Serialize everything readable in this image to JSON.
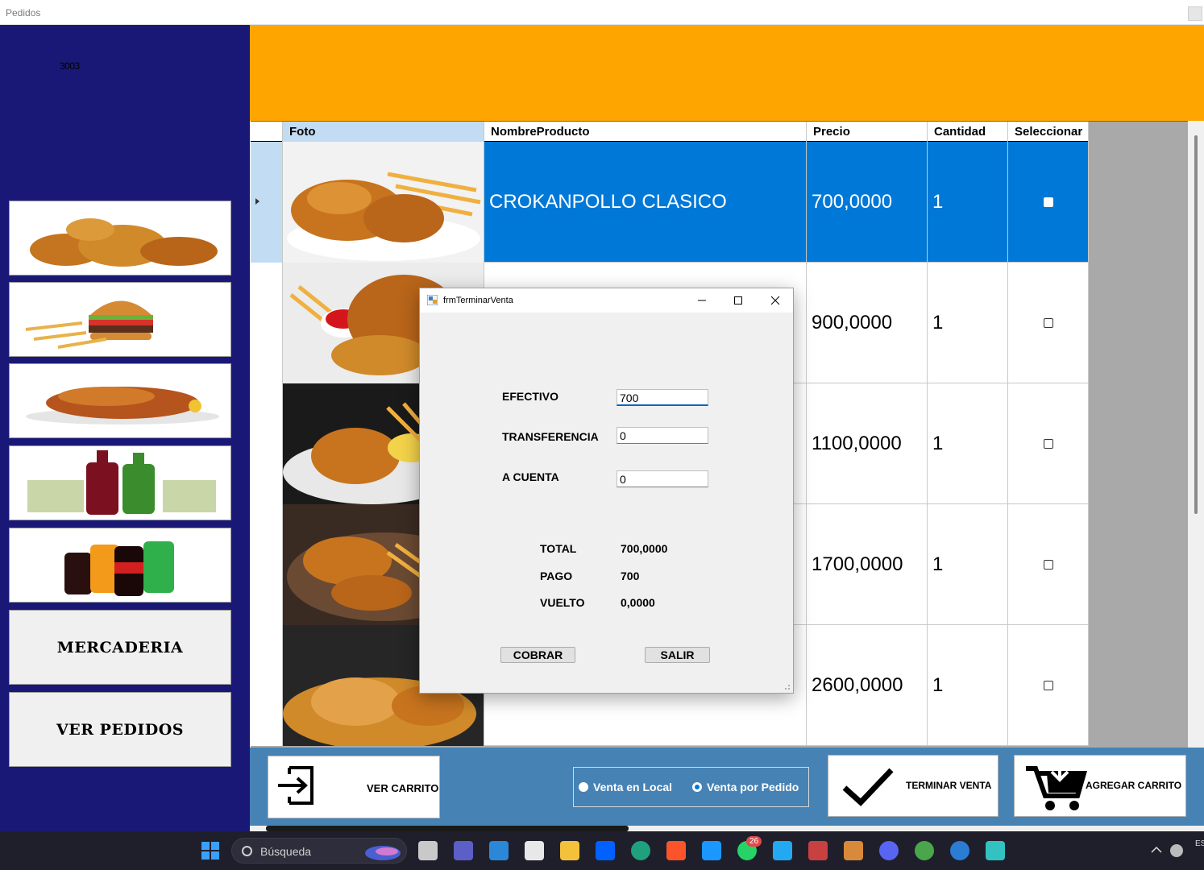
{
  "window": {
    "title": "Pedidos"
  },
  "sidebar": {
    "code": "3003",
    "buttons": [
      {
        "name": "pollo",
        "icon": "fried-chicken-image"
      },
      {
        "name": "hamburguesa",
        "icon": "burger-image"
      },
      {
        "name": "lechon",
        "icon": "roast-pig-image"
      },
      {
        "name": "vinos",
        "icon": "wine-image"
      },
      {
        "name": "gaseosas",
        "icon": "soda-image"
      }
    ],
    "mercaderia_label": "MERCADERIA",
    "ver_pedidos_label": "VER PEDIDOS"
  },
  "grid": {
    "columns": [
      "Foto",
      "NombreProducto",
      "Precio",
      "Cantidad",
      "Seleccionar"
    ],
    "rows": [
      {
        "nombre": "CROKANPOLLO CLASICO",
        "precio": "700,0000",
        "cantidad": "1",
        "selected": true
      },
      {
        "nombre": "",
        "precio": "900,0000",
        "cantidad": "1",
        "selected": false
      },
      {
        "nombre": "",
        "precio": "1100,0000",
        "cantidad": "1",
        "selected": false
      },
      {
        "nombre": "",
        "precio": "1700,0000",
        "cantidad": "1",
        "selected": false
      },
      {
        "nombre": "",
        "precio": "2600,0000",
        "cantidad": "1",
        "selected": false
      }
    ]
  },
  "bottom": {
    "ver_carrito": "VER CARRITO",
    "venta_local": "Venta en Local",
    "venta_pedido": "Venta por Pedido",
    "selected_radio": "Venta por Pedido",
    "terminar_venta": "TERMINAR VENTA",
    "agregar_carrito": "AGREGAR CARRITO"
  },
  "dialog": {
    "title": "frmTerminarVenta",
    "efectivo_label": "EFECTIVO",
    "efectivo_value": "700",
    "transferencia_label": "TRANSFERENCIA",
    "transferencia_value": "0",
    "a_cuenta_label": "A CUENTA",
    "a_cuenta_value": "0",
    "total_label": "TOTAL",
    "total_value": "700,0000",
    "pago_label": "PAGO",
    "pago_value": "700",
    "vuelto_label": "VUELTO",
    "vuelto_value": "0,0000",
    "cobrar_label": "COBRAR",
    "salir_label": "SALIR"
  },
  "taskbar": {
    "search_placeholder": "Búsqueda",
    "whatsapp_badge": "26",
    "lang": "ES",
    "colors": {
      "background": "#1f1f2b"
    }
  },
  "colors": {
    "sidebar": "#1a1877",
    "header": "#ffa500",
    "bottombar": "#4682b4",
    "selection": "#0078d7"
  }
}
